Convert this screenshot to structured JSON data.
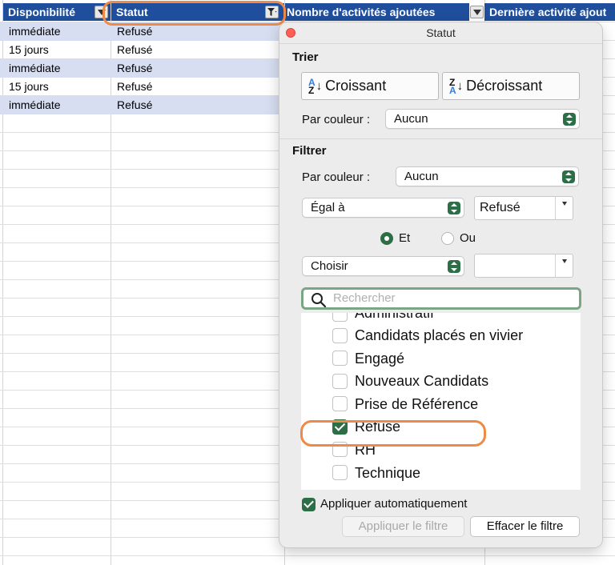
{
  "sheet": {
    "headers": {
      "disponibilite": "Disponibilité",
      "statut": "Statut",
      "nb_activites": "Nombre d'activités ajoutées",
      "derniere_activite": "Dernière activité ajout"
    },
    "rows": [
      {
        "disponibilite": "immédiate",
        "statut": "Refusé"
      },
      {
        "disponibilite": "15 jours",
        "statut": "Refusé"
      },
      {
        "disponibilite": "immédiate",
        "statut": "Refusé"
      },
      {
        "disponibilite": "15 jours",
        "statut": "Refusé"
      },
      {
        "disponibilite": "immédiate",
        "statut": "Refusé"
      }
    ],
    "header_color": "#1f4e9c",
    "alt_row_color": "#d7def1",
    "highlight_color": "#ee8a48"
  },
  "filter_popup": {
    "title": "Statut",
    "sort": {
      "section_title": "Trier",
      "ascending_label": "Croissant",
      "descending_label": "Décroissant",
      "by_color_label": "Par couleur :",
      "by_color_value": "Aucun"
    },
    "filter": {
      "section_title": "Filtrer",
      "by_color_label": "Par couleur :",
      "by_color_value": "Aucun",
      "condition1_operator": "Égal à",
      "condition1_value": "Refusé",
      "and_label": "Et",
      "or_label": "Ou",
      "logic_selected": "Et",
      "condition2_operator": "Choisir",
      "condition2_value": ""
    },
    "search_placeholder": "Rechercher",
    "values": [
      {
        "label": "Administratif",
        "checked": false
      },
      {
        "label": "Candidats placés en vivier",
        "checked": false
      },
      {
        "label": "Engagé",
        "checked": false
      },
      {
        "label": "Nouveaux Candidats",
        "checked": false
      },
      {
        "label": "Prise de Référence",
        "checked": false
      },
      {
        "label": "Refusé",
        "checked": true
      },
      {
        "label": "RH",
        "checked": false
      },
      {
        "label": "Technique",
        "checked": false
      }
    ],
    "auto_apply_label": "Appliquer automatiquement",
    "apply_button_label": "Appliquer le filtre",
    "clear_button_label": "Effacer le filtre",
    "accent_color": "#2c6e46"
  }
}
